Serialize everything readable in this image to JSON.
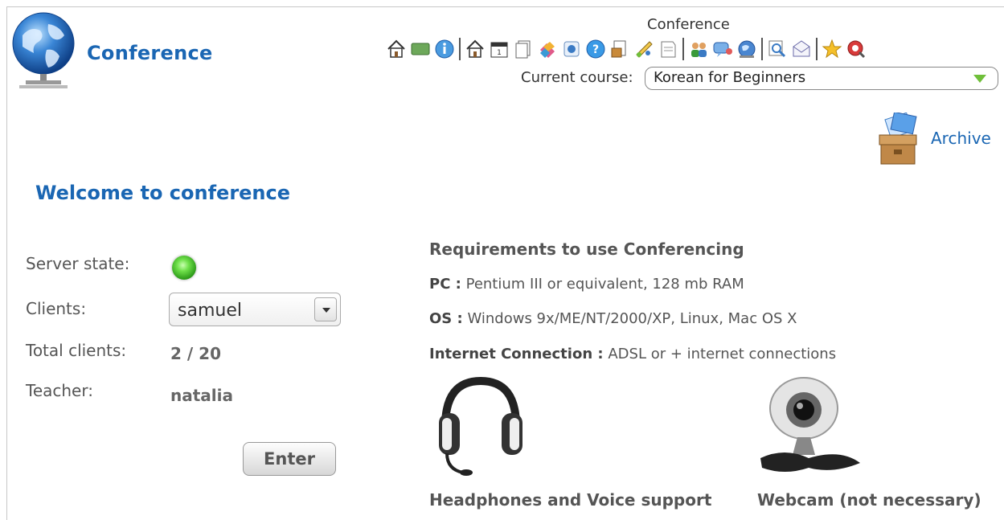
{
  "app": {
    "title": "Conference"
  },
  "header": {
    "toolbar_title": "Conference",
    "course_label": "Current course:",
    "current_course": "Korean for Beginners",
    "toolbar_icons": [
      "home-icon",
      "board-icon",
      "info-icon",
      "home-icon",
      "calendar-icon",
      "documents-icon",
      "tools-icon",
      "page-icon",
      "help-icon",
      "exercises-icon",
      "paint-icon",
      "notes-icon",
      "users-icon",
      "chat-icon",
      "globe-icon",
      "search-icon",
      "mail-icon",
      "star-icon",
      "logout-icon"
    ]
  },
  "archive": {
    "label": "Archive"
  },
  "welcome": {
    "title": "Welcome to conference"
  },
  "status": {
    "server_state_label": "Server state:",
    "server_state_color": "#3fbf2a",
    "clients_label": "Clients:",
    "clients_selected": "samuel",
    "total_clients_label": "Total clients:",
    "total_clients_value": "2 / 20",
    "teacher_label": "Teacher:",
    "teacher_value": "natalia",
    "enter_label": "Enter"
  },
  "requirements": {
    "title": "Requirements to use Conferencing",
    "pc_key": "PC :",
    "pc_value": "Pentium III or equivalent, 128 mb RAM",
    "os_key": "OS :",
    "os_value": "Windows 9x/ME/NT/2000/XP, Linux, Mac OS X",
    "net_key": "Internet Connection :",
    "net_value": "ADSL or + internet connections",
    "headphones_caption": "Headphones and Voice support",
    "webcam_caption": "Webcam (not necessary)"
  },
  "colors": {
    "brand_blue": "#1a66b3",
    "accent_green": "#6fbf3a"
  }
}
